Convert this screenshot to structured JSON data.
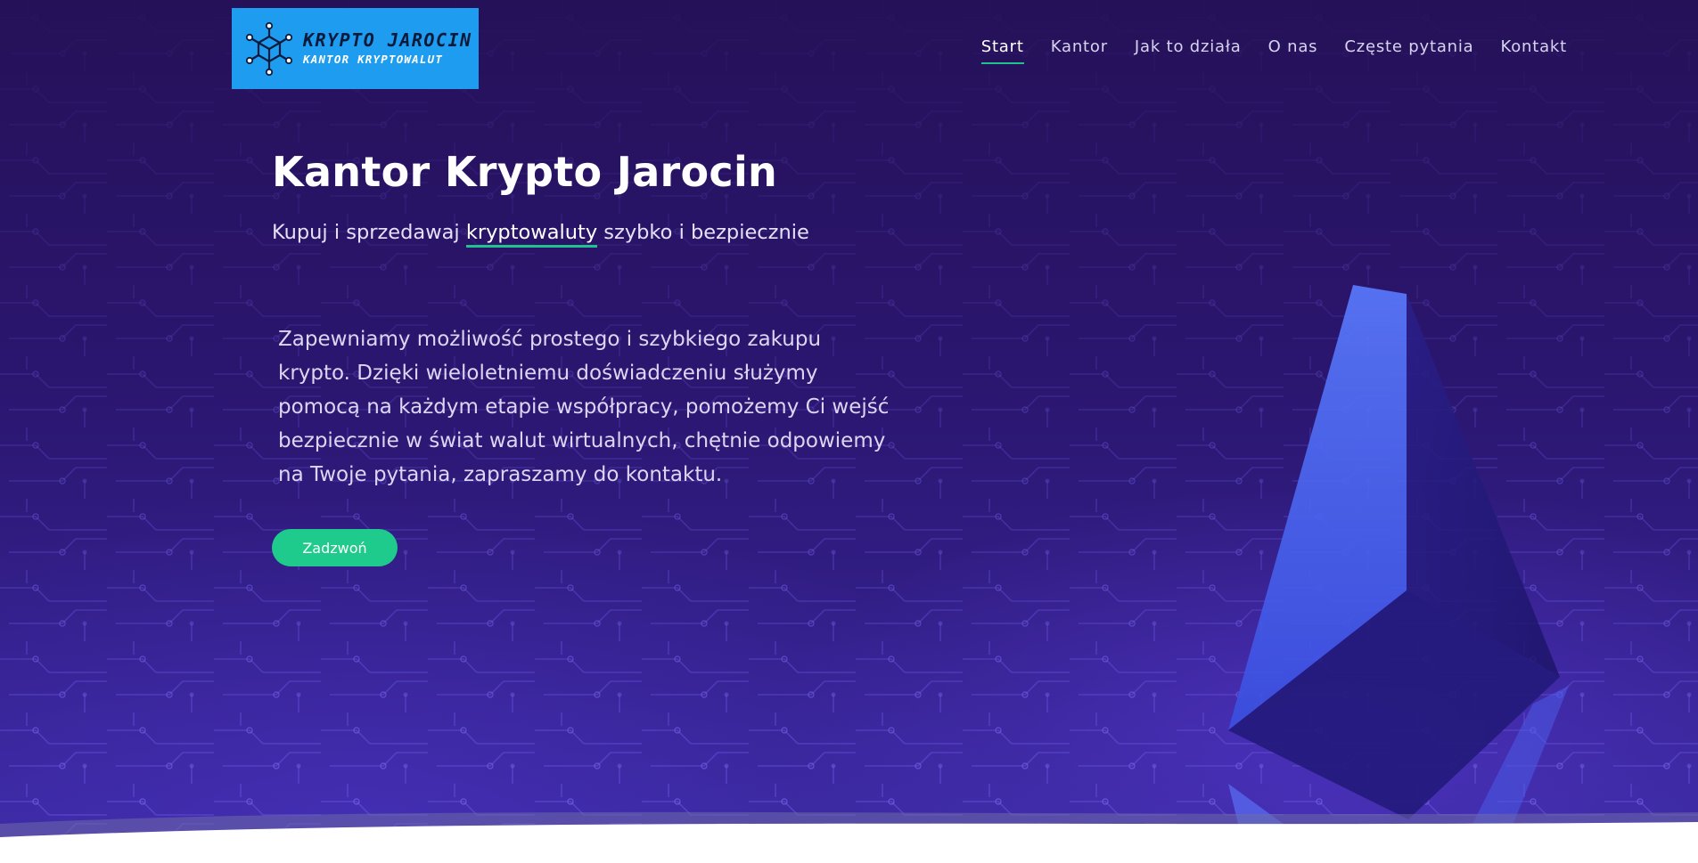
{
  "header": {
    "logo": {
      "title": "KRYPTO JAROCIN",
      "subtitle": "KANTOR KRYPTOWALUT",
      "icon": "cube-network-icon",
      "bg_color": "#1e9cf0"
    },
    "nav": [
      {
        "label": "Start",
        "active": true
      },
      {
        "label": "Kantor",
        "active": false
      },
      {
        "label": "Jak to działa",
        "active": false
      },
      {
        "label": "O nas",
        "active": false
      },
      {
        "label": "Częste pytania",
        "active": false
      },
      {
        "label": "Kontakt",
        "active": false
      }
    ]
  },
  "hero": {
    "title": "Kantor Krypto Jarocin",
    "subtitle_before": "Kupuj i sprzedawaj ",
    "subtitle_highlight": "kryptowaluty",
    "subtitle_after": " szybko i bezpiecznie",
    "description_lines": [
      "Zapewniamy możliwość prostego i szybkiego zakupu",
      "krypto. Dzięki wieloletniemu doświadczeniu służymy",
      "pomocą na każdym etapie współpracy, pomożemy Ci wejść",
      "bezpiecznie w świat walut wirtualnych, chętnie odpowiemy",
      "na Twoje pytania, zapraszamy do kontaktu."
    ],
    "cta_label": "Zadzwoń",
    "decoration_icon": "ethereum-crystal-icon"
  },
  "colors": {
    "background": "#2a1468",
    "accent": "#22c28c",
    "button": "#1fcb8c",
    "text": "#ffffff"
  }
}
